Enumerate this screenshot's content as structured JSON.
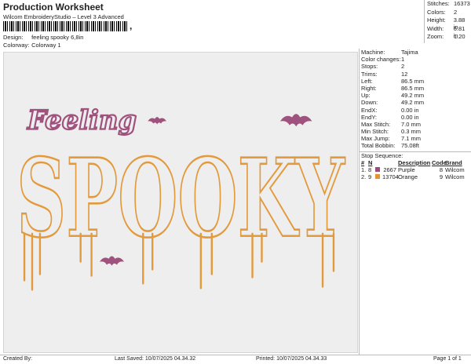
{
  "header": {
    "title": "Production Worksheet",
    "subtitle": "Wilcom EmbroideryStudio – Level 3 Advanced",
    "barcode_suffix": ",",
    "design_label": "Design:",
    "design_value": "feeling spooky 6,8in",
    "colorway_label": "Colorway:",
    "colorway_value": "Colorway 1"
  },
  "summary": [
    {
      "label": "Stitches:",
      "value": "16373"
    },
    {
      "label": "Colors:",
      "value": "2"
    },
    {
      "label": "Height:",
      "value": "3.88 in"
    },
    {
      "label": "Width:",
      "value": "6.81 in"
    },
    {
      "label": "Zoom:",
      "value": "1.20"
    }
  ],
  "machine_info": [
    {
      "label": "Machine:",
      "value": "Tajima"
    },
    {
      "label": "Color changes:",
      "value": "1"
    },
    {
      "label": "Stops:",
      "value": "2"
    },
    {
      "label": "Trims:",
      "value": "12"
    },
    {
      "label": "Left:",
      "value": "86.5 mm"
    },
    {
      "label": "Right:",
      "value": "86.5 mm"
    },
    {
      "label": "Up:",
      "value": "49.2 mm"
    },
    {
      "label": "Down:",
      "value": "49.2 mm"
    },
    {
      "label": "EndX:",
      "value": "0.00 in"
    },
    {
      "label": "EndY:",
      "value": "0.00 in"
    },
    {
      "label": "Max Stitch:",
      "value": "7.0 mm"
    },
    {
      "label": "Min Stitch:",
      "value": "0.3 mm"
    },
    {
      "label": "Max Jump:",
      "value": "7.1 mm"
    },
    {
      "label": "Total Bobbin:",
      "value": "75.08ft"
    }
  ],
  "stop_sequence": {
    "title": "Stop Sequence:",
    "columns": [
      "#",
      "N",
      "",
      "Description",
      "Code",
      "Brand"
    ],
    "rows": [
      {
        "num": "1.",
        "n": "8",
        "color": "#9b4d7a",
        "stitches": "2667",
        "description": "Purple",
        "code": "8",
        "brand": "Wilcom"
      },
      {
        "num": "2.",
        "n": "9",
        "color": "#e8922e",
        "stitches": "13704",
        "description": "Orange",
        "code": "9",
        "brand": "Wilcom"
      }
    ]
  },
  "design": {
    "script_word": "Feeling",
    "block_word": "SPOOKY",
    "purple": "#a0527e",
    "orange": "#e39a3c"
  },
  "footer": {
    "created_by": "Created By:",
    "last_saved": "Last Saved: 10/07/2025 04.34.32",
    "printed": "Printed: 10/07/2025 04.34.33",
    "page": "Page 1 of 1"
  }
}
